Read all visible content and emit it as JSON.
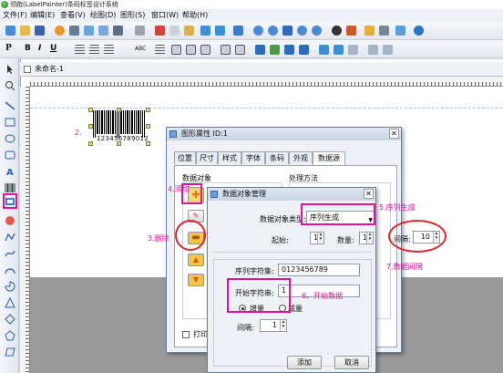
{
  "app": {
    "title": "领跑(LabelPainter)条码标签设计系统"
  },
  "menu": [
    "文件(F)",
    "编辑(E)",
    "查看(V)",
    "绘图(D)",
    "图形(S)",
    "窗口(W)",
    "帮助(H)"
  ],
  "toolbar2": {
    "bold": "B",
    "italic": "I",
    "underline": "U",
    "text_abc": "ABC"
  },
  "doc": {
    "tab": "未命名-1"
  },
  "barcode": {
    "digits": "123456789012"
  },
  "annotations": {
    "a2": "2.",
    "a3": "3.删除",
    "a4": "4.添加",
    "a5": "5.序列生成",
    "a6": "6、开始数据",
    "a7": "7.数据间隔"
  },
  "props_dialog": {
    "title": "图形属性 ID:1",
    "tabs": [
      "位置",
      "尺寸",
      "样式",
      "字体",
      "条码",
      "外观",
      "数据源"
    ],
    "data_object_label": "数据对象",
    "processing_label": "处理方法",
    "print_label": "打印时"
  },
  "data_dialog": {
    "title": "数据对象管理",
    "type_label": "数据对象类型:",
    "type_value": "序列生成",
    "start_label": "起始:",
    "start_value": "1",
    "count_label": "数量:",
    "count_value": "1",
    "interval_label": "间隔:",
    "interval_value": "10",
    "seq_label": "序列字符集:",
    "seq_value": "0123456789",
    "start_str_label": "开始字符串:",
    "start_str_value": "1",
    "radio_inc": "增量",
    "radio_dec": "减量",
    "step_label": "间隔:",
    "step_value": "1",
    "add_button": "添加",
    "cancel_button": "取消"
  },
  "colors": {
    "accent": "#e0149b",
    "red": "#e1262d"
  }
}
